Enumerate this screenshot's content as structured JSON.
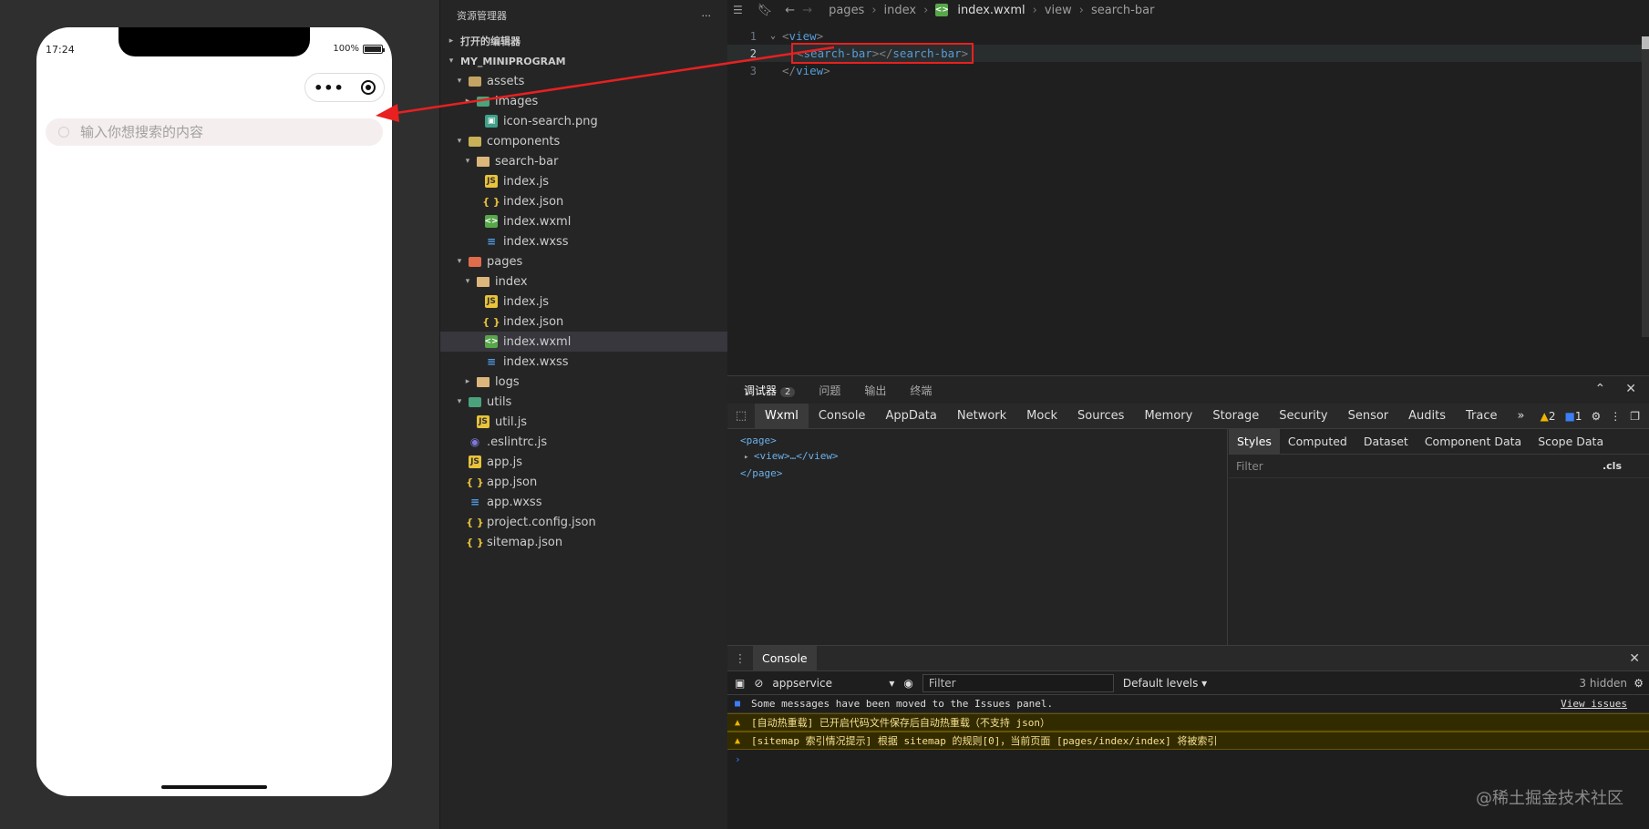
{
  "simulator": {
    "time": "17:24",
    "battery": "100%",
    "search_placeholder": "输入你想搜索的内容"
  },
  "explorer": {
    "title": "资源管理器",
    "more": "···",
    "open_editors": "打开的编辑器",
    "project": "MY_MINIPROGRAM",
    "items": [
      {
        "label": "assets",
        "depth": 1,
        "twisty": "▾",
        "icon": "folder-assets"
      },
      {
        "label": "images",
        "depth": 2,
        "twisty": "▸",
        "icon": "folder-img"
      },
      {
        "label": "icon-search.png",
        "depth": 3,
        "twisty": "",
        "icon": "png"
      },
      {
        "label": "components",
        "depth": 1,
        "twisty": "▾",
        "icon": "folder-comp"
      },
      {
        "label": "search-bar",
        "depth": 2,
        "twisty": "▾",
        "icon": "folder"
      },
      {
        "label": "index.js",
        "depth": 3,
        "twisty": "",
        "icon": "js"
      },
      {
        "label": "index.json",
        "depth": 3,
        "twisty": "",
        "icon": "json"
      },
      {
        "label": "index.wxml",
        "depth": 3,
        "twisty": "",
        "icon": "wxml"
      },
      {
        "label": "index.wxss",
        "depth": 3,
        "twisty": "",
        "icon": "wxss"
      },
      {
        "label": "pages",
        "depth": 1,
        "twisty": "▾",
        "icon": "folder-pages"
      },
      {
        "label": "index",
        "depth": 2,
        "twisty": "▾",
        "icon": "folder"
      },
      {
        "label": "index.js",
        "depth": 3,
        "twisty": "",
        "icon": "js"
      },
      {
        "label": "index.json",
        "depth": 3,
        "twisty": "",
        "icon": "json"
      },
      {
        "label": "index.wxml",
        "depth": 3,
        "twisty": "",
        "icon": "wxml",
        "selected": true
      },
      {
        "label": "index.wxss",
        "depth": 3,
        "twisty": "",
        "icon": "wxss"
      },
      {
        "label": "logs",
        "depth": 2,
        "twisty": "▸",
        "icon": "folder"
      },
      {
        "label": "utils",
        "depth": 1,
        "twisty": "▾",
        "icon": "folder-img"
      },
      {
        "label": "util.js",
        "depth": 2,
        "twisty": "",
        "icon": "js"
      },
      {
        "label": ".eslintrc.js",
        "depth": 1,
        "twisty": "",
        "icon": "eslint"
      },
      {
        "label": "app.js",
        "depth": 1,
        "twisty": "",
        "icon": "js"
      },
      {
        "label": "app.json",
        "depth": 1,
        "twisty": "",
        "icon": "json"
      },
      {
        "label": "app.wxss",
        "depth": 1,
        "twisty": "",
        "icon": "wxss"
      },
      {
        "label": "project.config.json",
        "depth": 1,
        "twisty": "",
        "icon": "json"
      },
      {
        "label": "sitemap.json",
        "depth": 1,
        "twisty": "",
        "icon": "json"
      }
    ]
  },
  "editor": {
    "breadcrumb": [
      "pages",
      "index",
      "index.wxml",
      "view",
      "search-bar"
    ],
    "lines": [
      {
        "num": "1",
        "open": "view"
      },
      {
        "num": "2",
        "tag": "search-bar"
      },
      {
        "num": "3",
        "close": "view"
      }
    ]
  },
  "debugger": {
    "tabs": [
      "调试器",
      "问题",
      "输出",
      "终端"
    ],
    "tab_badge": "2",
    "panel_tabs": [
      "Wxml",
      "Console",
      "AppData",
      "Network",
      "Mock",
      "Sources",
      "Memory",
      "Storage",
      "Security",
      "Sensor",
      "Audits",
      "Trace"
    ],
    "warn_count": "2",
    "info_count": "1",
    "wxml_lines": [
      "<page>",
      "<view>…</view>",
      "</page>"
    ],
    "style_tabs": [
      "Styles",
      "Computed",
      "Dataset",
      "Component Data",
      "Scope Data"
    ],
    "filter_placeholder": "Filter",
    "cls_label": ".cls"
  },
  "console": {
    "tab": "Console",
    "context": "appservice",
    "filter_placeholder": "Filter",
    "levels": "Default levels",
    "hidden": "3 hidden",
    "messages": [
      {
        "type": "info",
        "text": "Some messages have been moved to the Issues panel.",
        "link": "View issues"
      },
      {
        "type": "warn",
        "text": "[自动热重载] 已开启代码文件保存后自动热重载（不支持 json）"
      },
      {
        "type": "warn",
        "text": "[sitemap 索引情况提示] 根据 sitemap 的规则[0]，当前页面 [pages/index/index] 将被索引"
      }
    ],
    "prompt": "›"
  },
  "watermark": "@稀土掘金技术社区",
  "colors": {
    "highlight": "#e82020",
    "tag": "#569cd6",
    "warn_bg": "#332b00"
  }
}
